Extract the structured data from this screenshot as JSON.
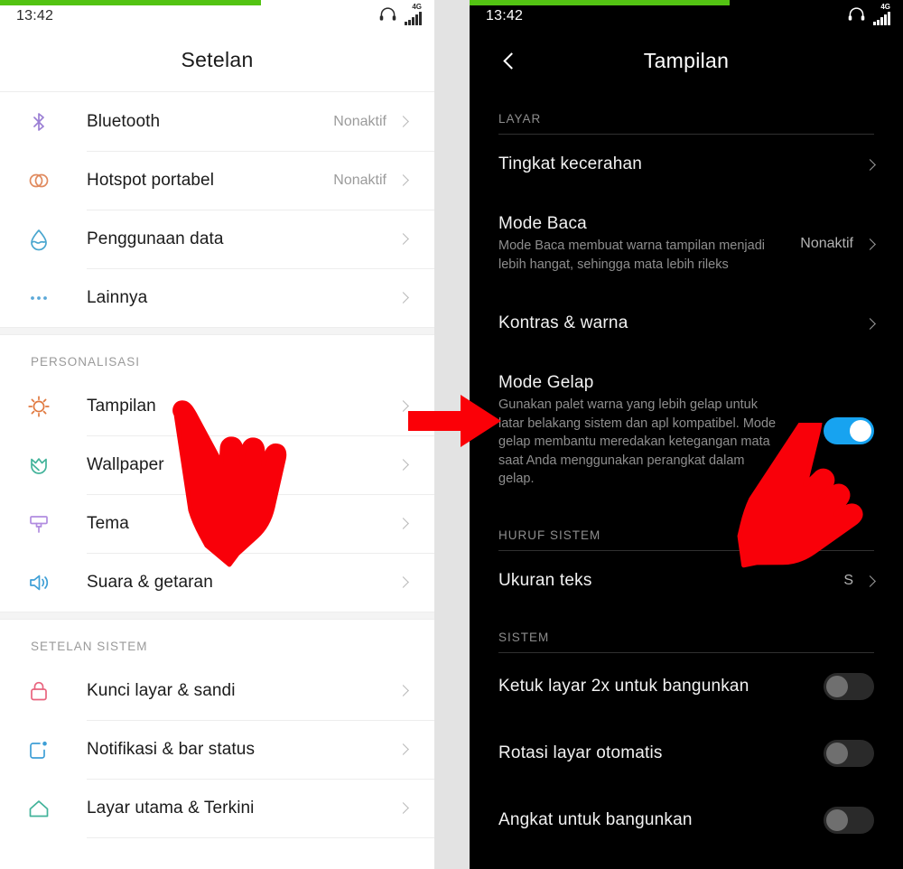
{
  "colors": {
    "accent_green": "#53c313",
    "toggle_on": "#17a3f0",
    "annotation_red": "#fb0007",
    "left_bg": "#ffffff",
    "right_bg": "#000000"
  },
  "left_panel": {
    "status": {
      "time": "13:42",
      "network": "4G",
      "headset_icon": "headphones-icon",
      "signal_icon": "signal-bars-icon"
    },
    "title": "Setelan",
    "groups": [
      {
        "header": null,
        "items": [
          {
            "icon": "bluetooth-icon",
            "icon_color": "#9b7fd4",
            "label": "Bluetooth",
            "value": "Nonaktif"
          },
          {
            "icon": "hotspot-icon",
            "icon_color": "#e08a5e",
            "label": "Hotspot portabel",
            "value": "Nonaktif"
          },
          {
            "icon": "data-usage-icon",
            "icon_color": "#49a6cf",
            "label": "Penggunaan data",
            "value": ""
          },
          {
            "icon": "more-icon",
            "icon_color": "#5ba8d8",
            "label": "Lainnya",
            "value": ""
          }
        ]
      },
      {
        "header": "PERSONALISASI",
        "items": [
          {
            "icon": "brightness-sun-icon",
            "icon_color": "#e0793f",
            "label": "Tampilan",
            "value": ""
          },
          {
            "icon": "flower-wallpaper-icon",
            "icon_color": "#42b39a",
            "label": "Wallpaper",
            "value": ""
          },
          {
            "icon": "paint-brush-icon",
            "icon_color": "#b18ce0",
            "label": "Tema",
            "value": ""
          },
          {
            "icon": "speaker-sound-icon",
            "icon_color": "#3e9fd6",
            "label": "Suara & getaran",
            "value": ""
          }
        ]
      },
      {
        "header": "SETELAN SISTEM",
        "items": [
          {
            "icon": "lock-icon",
            "icon_color": "#e8647e",
            "label": "Kunci layar & sandi",
            "value": ""
          },
          {
            "icon": "notification-square-icon",
            "icon_color": "#3e9fd6",
            "label": "Notifikasi & bar status",
            "value": ""
          },
          {
            "icon": "home-icon",
            "icon_color": "#42b39a",
            "label": "Layar utama & Terkini",
            "value": ""
          }
        ]
      }
    ]
  },
  "right_panel": {
    "status": {
      "time": "13:42",
      "network": "4G",
      "headset_icon": "headphones-icon",
      "signal_icon": "signal-bars-icon"
    },
    "back_icon": "back-chevron-icon",
    "title": "Tampilan",
    "sections": [
      {
        "header": "LAYAR",
        "items": [
          {
            "name": "tingkat-kecerahan",
            "title": "Tingkat kecerahan",
            "desc": "",
            "value": "",
            "control": "chevron"
          },
          {
            "name": "mode-baca",
            "title": "Mode Baca",
            "desc": "Mode Baca membuat warna tampilan menjadi lebih hangat, sehingga mata lebih rileks",
            "value": "Nonaktif",
            "control": "chevron"
          },
          {
            "name": "kontras-warna",
            "title": "Kontras & warna",
            "desc": "",
            "value": "",
            "control": "chevron"
          },
          {
            "name": "mode-gelap",
            "title": "Mode Gelap",
            "desc": "Gunakan palet warna yang lebih gelap untuk latar belakang sistem dan apl kompatibel. Mode gelap membantu meredakan ketegangan mata saat Anda menggunakan perangkat dalam gelap.",
            "value": "",
            "control": "toggle",
            "toggle_state": "on"
          }
        ]
      },
      {
        "header": "HURUF SISTEM",
        "items": [
          {
            "name": "ukuran-teks",
            "title": "Ukuran teks",
            "desc": "",
            "value": "S",
            "control": "chevron"
          }
        ]
      },
      {
        "header": "SISTEM",
        "items": [
          {
            "name": "ketuk-layar-2x",
            "title": "Ketuk layar 2x untuk bangunkan",
            "desc": "",
            "value": "",
            "control": "toggle",
            "toggle_state": "off"
          },
          {
            "name": "rotasi-layar-otomatis",
            "title": "Rotasi layar otomatis",
            "desc": "",
            "value": "",
            "control": "toggle",
            "toggle_state": "off"
          },
          {
            "name": "angkat-untuk-bangunkan",
            "title": "Angkat untuk bangunkan",
            "desc": "",
            "value": "",
            "control": "toggle",
            "toggle_state": "off"
          }
        ]
      }
    ]
  },
  "annotations": {
    "arrow": "red-arrow-pointing-right",
    "hand_left": "red-pointing-hand-cursor",
    "hand_right": "red-pointing-hand-cursor"
  }
}
